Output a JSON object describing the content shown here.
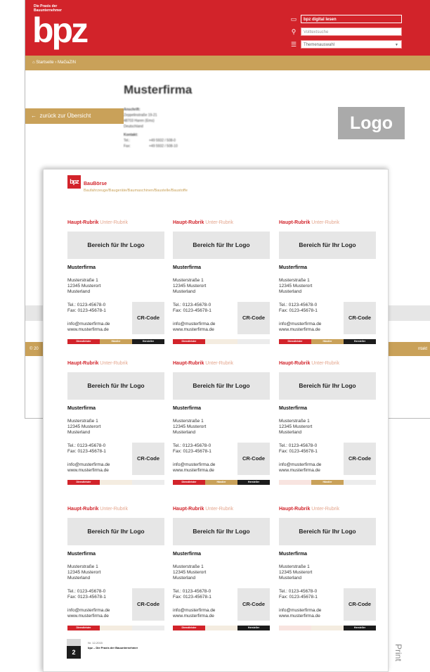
{
  "colors": {
    "red": "#d2232a",
    "gold": "#c9a159",
    "dark": "#1c1c1c",
    "grey_box": "#e6e6e6"
  },
  "web": {
    "tagline": "Die Praxis der Bauunternehmer",
    "logo": "bpz",
    "digital_button": "bpz digital lesen",
    "search_placeholder": "Volltextsuche",
    "theme_select": "Themenauswahl",
    "breadcrumb": [
      "Startseite",
      "MaGaZIN"
    ],
    "company_title": "Musterfirma",
    "back_button": "zurück zur Übersicht",
    "logo_placeholder": "Logo",
    "anschrift_label": "Anschrift:",
    "anschrift_lines": [
      "Zeppelinstraße 19-21",
      "48703 Haren (Ems)",
      "Deutschland"
    ],
    "kontakt_label": "Kontakt:",
    "tel_label": "Tel.:",
    "tel_value": "+49 5932 / 508-0",
    "fax_label": "Fax:",
    "fax_value": "+49 5932 / 508-10",
    "copyright": "© 20",
    "kontakt_link": "ntakt"
  },
  "print": {
    "logo": "bpz",
    "title": "BauBörse",
    "subtitle": "Baufahrzeuge/Baugeräte/Baumaschinen/Baustelle/Baustoffe",
    "footer_issue": "Nr. 12-2015",
    "footer_title": "bpz – Die Praxis der Bauunternehmer",
    "page_number": "2",
    "side_label": "Print"
  },
  "card_template": {
    "main_rubrik": "Haupt-Rubrik",
    "sub_rubrik": "Unter-Rubrik",
    "logo_area": "Bereich für Ihr Logo",
    "company": "Musterfirma",
    "street": "Musterstraße 1",
    "city": "12345 Musterort",
    "country": "Musterland",
    "tel": "Tel.: 0123-45678-0",
    "fax": "Fax: 0123-45678-1",
    "qr": "CR-Code",
    "email": "info@musterfirma.de",
    "web": "www.musterfirma.de",
    "categories": [
      "Dienstleister",
      "Händler",
      "Hersteller"
    ]
  },
  "cards": [
    {
      "active": [
        true,
        true,
        true
      ]
    },
    {
      "active": [
        true,
        false,
        false
      ]
    },
    {
      "active": [
        true,
        true,
        true
      ]
    },
    {
      "active": [
        true,
        false,
        false
      ]
    },
    {
      "active": [
        true,
        true,
        true
      ]
    },
    {
      "active": [
        false,
        true,
        false
      ]
    },
    {
      "active": [
        true,
        false,
        false
      ]
    },
    {
      "active": [
        true,
        false,
        true
      ]
    },
    {
      "active": [
        false,
        false,
        true
      ]
    }
  ]
}
